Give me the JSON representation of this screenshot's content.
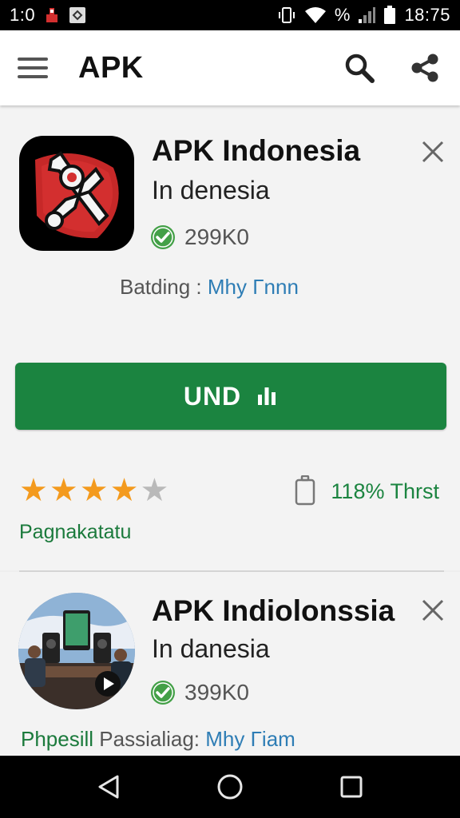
{
  "status_bar": {
    "left_time": "1:0",
    "right_time": "18:75",
    "percent_glyph": "%"
  },
  "app_bar": {
    "title": "APK"
  },
  "card1": {
    "title": "APK Indonesia",
    "subtitle": "In denesia",
    "downloads": "299K0",
    "developer_label": "Batding :",
    "developer_name": "Mhy Γnnn",
    "install_label": "UND",
    "rating": 4,
    "rating_max": 5,
    "size_text": "118% Thrst",
    "category": "Pagnakatatu"
  },
  "card2": {
    "title": "APK Indiolonssia",
    "subtitle": "In danesia",
    "downloads": "399K0",
    "developer_label_green": "Phpesill",
    "developer_label_grey": "Passialiag:",
    "developer_name": "Mhy Γiam"
  },
  "colors": {
    "install_green": "#1b8440",
    "link_blue": "#2e7db5",
    "star_orange": "#f39a1e",
    "verified_green": "#43a047"
  },
  "icons": [
    "menu-icon",
    "search-icon",
    "share-icon",
    "close-icon",
    "verified-icon",
    "battery-icon",
    "back-icon",
    "home-icon",
    "recents-icon"
  ]
}
